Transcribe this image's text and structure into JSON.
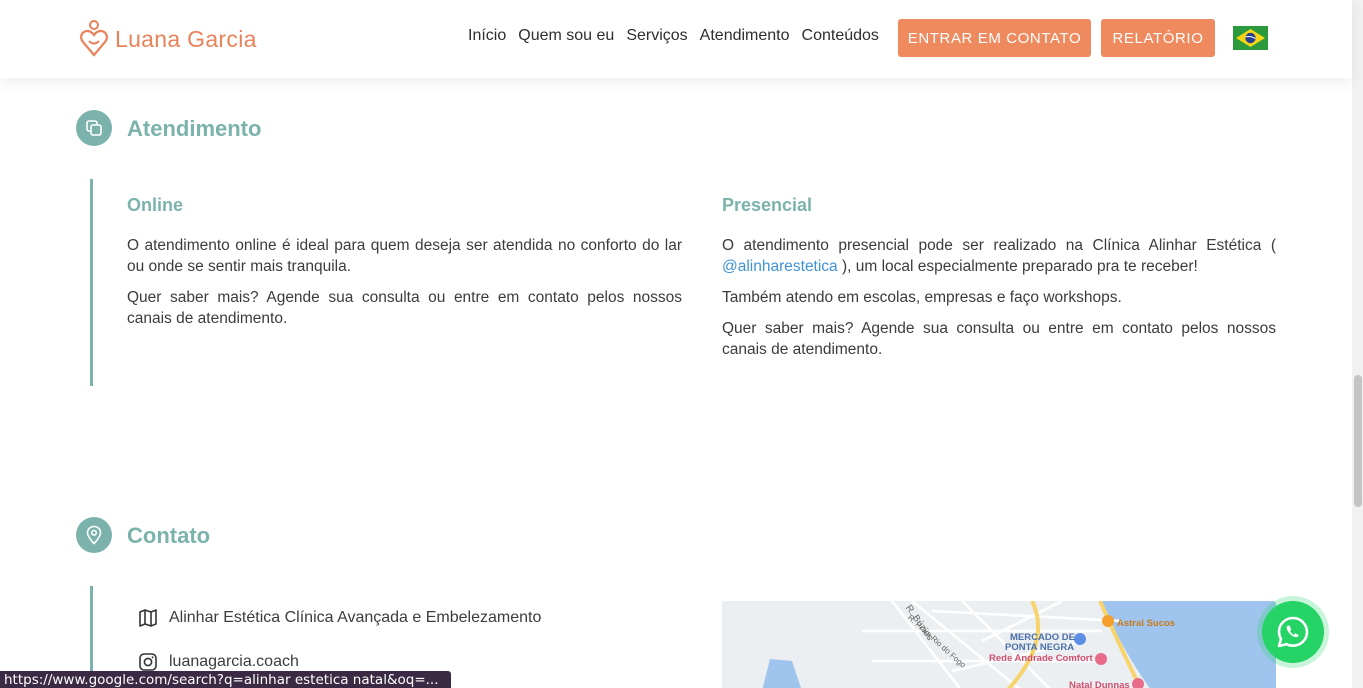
{
  "header": {
    "logo_text": "Luana Garcia",
    "nav": [
      "Início",
      "Quem sou eu",
      "Serviços",
      "Atendimento",
      "Conteúdos"
    ],
    "contact_button": "ENTRAR EM CONTATO",
    "report_button": "RELATÓRIO",
    "flag_icon": "brazil-flag-icon"
  },
  "atendimento": {
    "title": "Atendimento",
    "online": {
      "title": "Online",
      "p1": "O atendimento online é ideal para quem deseja ser atendida no conforto do lar ou onde se sentir mais tranquila.",
      "p2": "Quer saber mais? Agende sua consulta ou entre em contato pelos nossos canais de atendimento."
    },
    "presencial": {
      "title": "Presencial",
      "p1_before": "O atendimento presencial pode ser realizado na Clínica Alinhar Estética (",
      "p1_link": "@alinharestetica",
      "p1_after": "), um local especialmente preparado pra te receber!",
      "p2": "Também atendo em escolas, empresas e faço workshops.",
      "p3": "Quer saber mais? Agende sua consulta ou entre em contato pelos nossos canais de atendimento."
    }
  },
  "contato": {
    "title": "Contato",
    "address": "Alinhar Estética Clínica Avançada e Embelezamento",
    "instagram": "luanagarcia.coach"
  },
  "map": {
    "labels": [
      "R. Búzios",
      "R. Praia Rio do Fogo",
      "MERCADO DE",
      "PONTA NEGRA",
      "Rede Andrade Comfort",
      "Astral Sucos",
      "Natal Dunnas"
    ]
  },
  "status_bar": "https://www.google.com/search?q=alinhar estetica natal&oq=...",
  "colors": {
    "accent": "#7bb3ac",
    "orange": "#ef8a5f",
    "link": "#3f93d6"
  }
}
